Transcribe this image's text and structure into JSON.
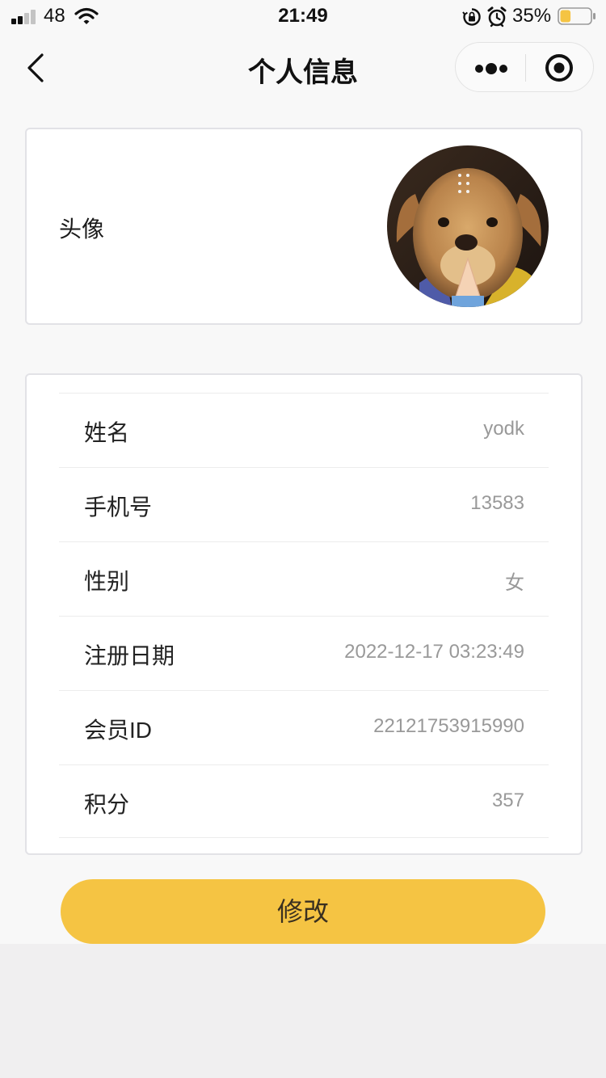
{
  "status_bar": {
    "carrier": "48",
    "time": "21:49",
    "battery_percent": "35%",
    "battery_level": 0.35,
    "battery_color": "#f5c443",
    "icons": [
      "signal-icon",
      "wifi-icon",
      "rotation-lock-icon",
      "alarm-icon",
      "battery-icon"
    ]
  },
  "nav": {
    "title": "个人信息",
    "icons": [
      "back-icon",
      "more-icon",
      "close-target-icon"
    ]
  },
  "avatar_card": {
    "label": "头像",
    "image": "avatar-photo-dog"
  },
  "info": {
    "rows": [
      {
        "label": "姓名",
        "value": "yodk"
      },
      {
        "label": "手机号",
        "value": "13583"
      },
      {
        "label": "性别",
        "value": "女"
      },
      {
        "label": "注册日期",
        "value": "2022-12-17 03:23:49"
      },
      {
        "label": "会员ID",
        "value": "22121753915990"
      },
      {
        "label": "积分",
        "value": "357"
      }
    ]
  },
  "actions": {
    "edit_label": "修改",
    "accent_color": "#f5c443"
  }
}
